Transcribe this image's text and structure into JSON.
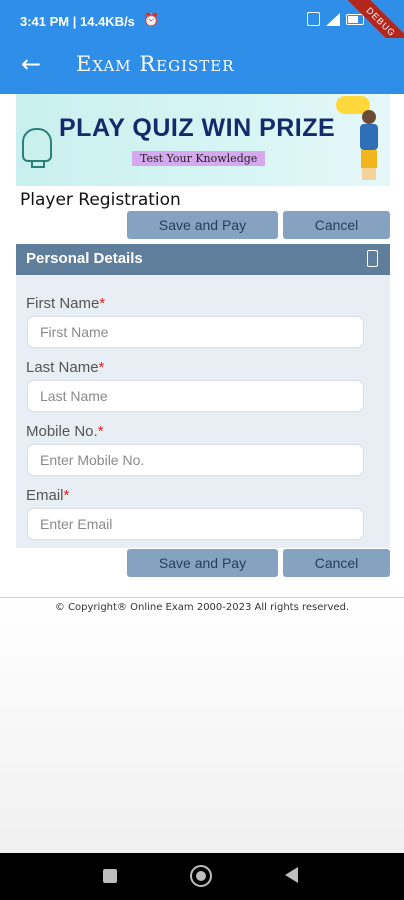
{
  "status_bar": {
    "time": "3:41 PM | 14.4KB/s",
    "alarm_icon": "alarm-icon",
    "debug_label": "DEBUG"
  },
  "app_bar": {
    "title": "Exam Register",
    "back_icon": "arrow-left-icon"
  },
  "banner": {
    "headline": "PLAY QUIZ WIN PRIZE",
    "tagline": "Test Your Knowledge"
  },
  "page": {
    "title": "Player Registration"
  },
  "actions": {
    "save_label": "Save and Pay",
    "cancel_label": "Cancel"
  },
  "section": {
    "title": "Personal Details",
    "icon": "phone-icon"
  },
  "form": {
    "fields": [
      {
        "label": "First Name",
        "required": "*",
        "placeholder": "First Name"
      },
      {
        "label": "Last Name",
        "required": "*",
        "placeholder": "Last Name"
      },
      {
        "label": "Mobile No.",
        "required": "*",
        "placeholder": "Enter Mobile No."
      },
      {
        "label": "Email",
        "required": "*",
        "placeholder": "Enter Email"
      }
    ]
  },
  "footer": {
    "copyright": "© Copyright® Online Exam 2000-2023 All rights reserved."
  },
  "colors": {
    "app_bar": "#2f8ee8",
    "button": "#85a3c1",
    "section_header": "#5f7e9c",
    "form_bg": "#e9eef4",
    "required": "#e02020"
  }
}
